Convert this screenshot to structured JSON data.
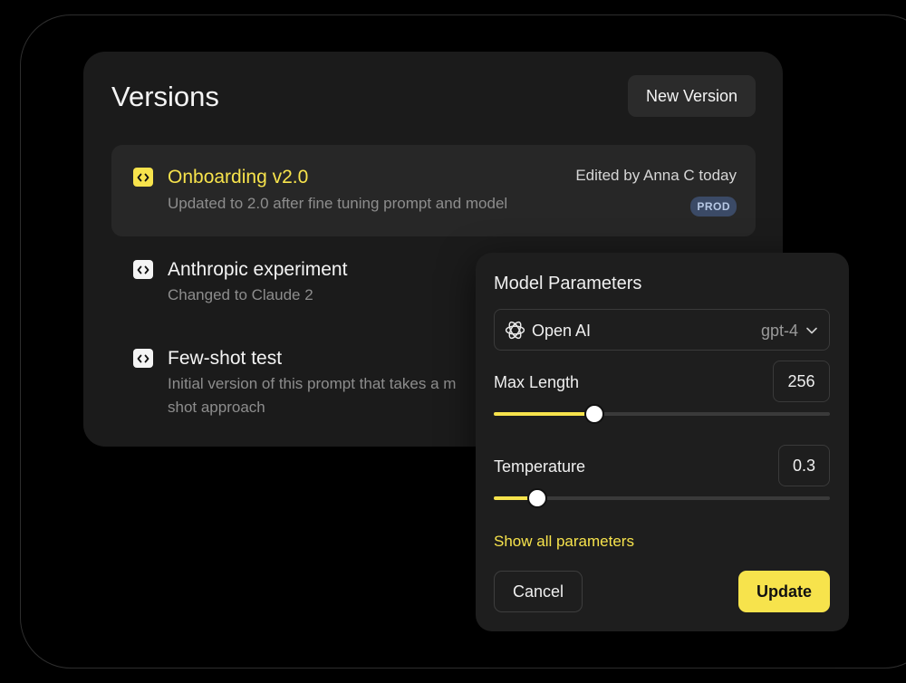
{
  "versions": {
    "title": "Versions",
    "new_version_label": "New Version",
    "items": [
      {
        "name": "Onboarding v2.0",
        "description": "Updated to 2.0 after fine tuning prompt and model",
        "meta": "Edited by Anna C today",
        "badge": "PROD"
      },
      {
        "name": "Anthropic experiment",
        "description": "Changed to Claude 2"
      },
      {
        "name": "Few-shot test",
        "description": "Initial version of this prompt that takes a m",
        "description_line2": "shot approach"
      }
    ]
  },
  "params": {
    "title": "Model Parameters",
    "provider": "Open AI",
    "model": "gpt-4",
    "max_length": {
      "label": "Max Length",
      "value": "256",
      "fill": 0.3
    },
    "temperature": {
      "label": "Temperature",
      "value": "0.3",
      "fill": 0.13
    },
    "show_all_label": "Show all parameters",
    "cancel_label": "Cancel",
    "update_label": "Update"
  },
  "colors": {
    "accent": "#f7e34c",
    "badge_bg": "#3b4a66"
  }
}
